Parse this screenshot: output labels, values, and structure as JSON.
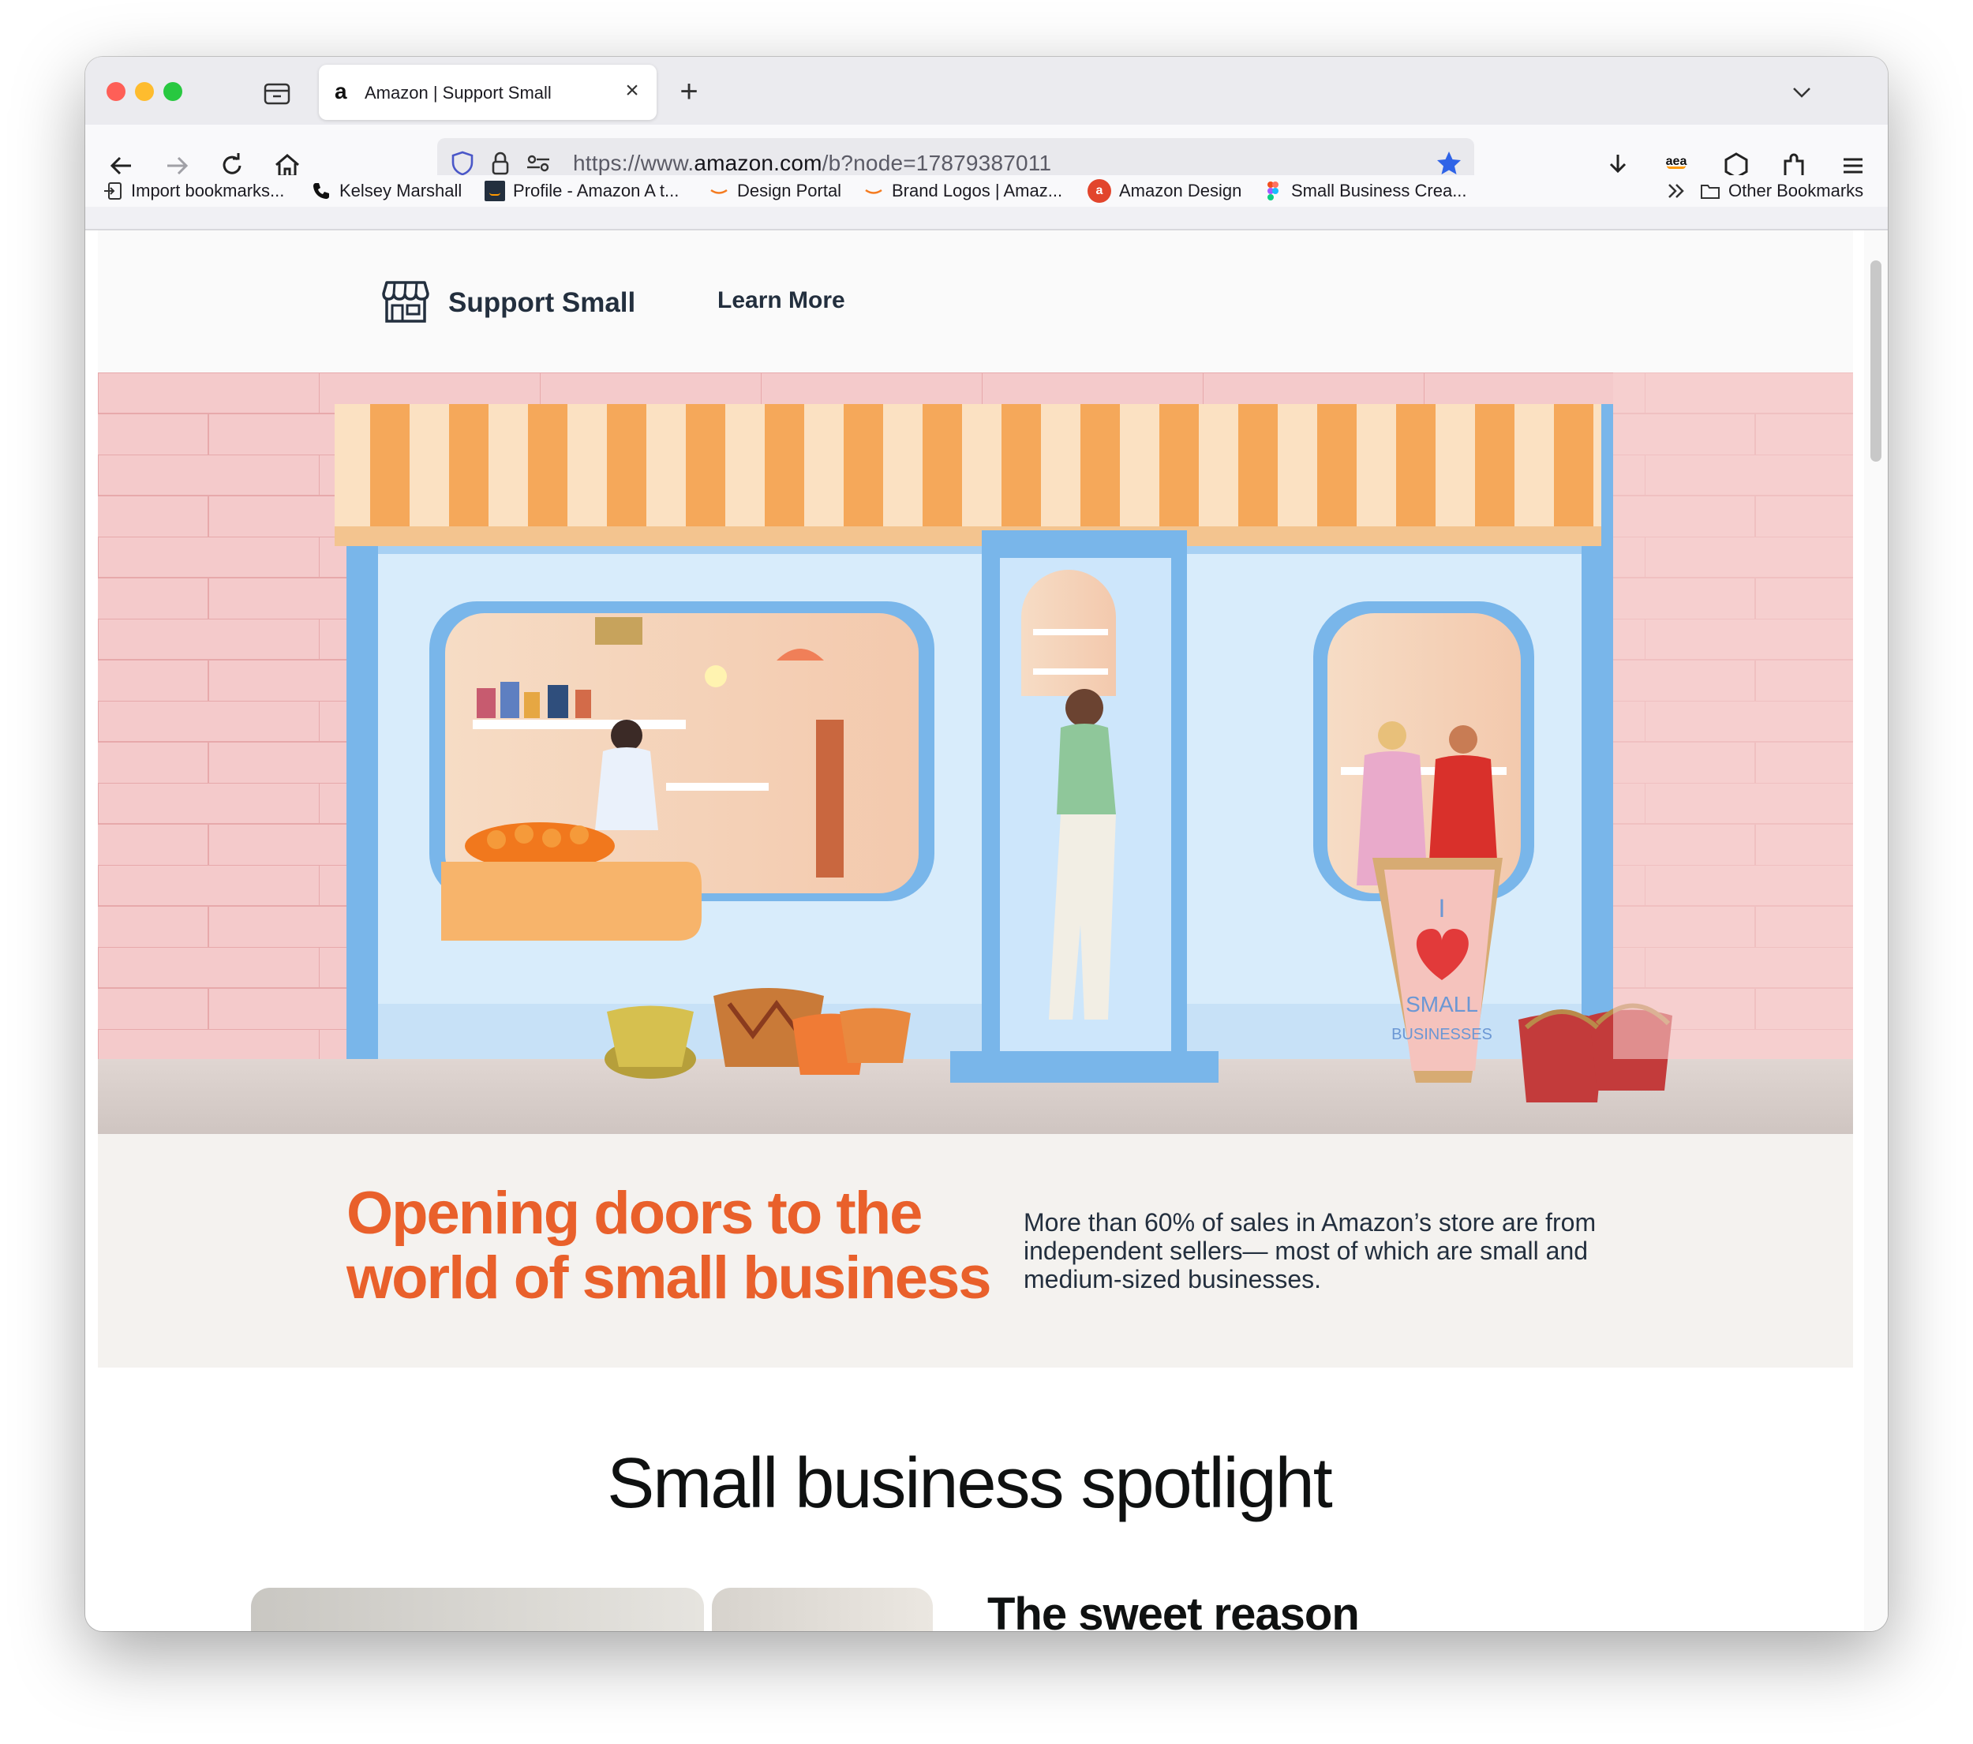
{
  "browser": {
    "tab": {
      "favicon": "a",
      "title": "Amazon | Support Small"
    },
    "url": {
      "prefix": "https://www.",
      "domain": "amazon.com",
      "path": "/b?node=17879387011"
    },
    "extension_label": "aea",
    "bookmarks": [
      {
        "label": "Import bookmarks...",
        "icon": "import-icon"
      },
      {
        "label": "Kelsey Marshall",
        "icon": "phone-icon"
      },
      {
        "label": "Profile - Amazon A t...",
        "icon": "amazon-dark-icon"
      },
      {
        "label": "Design Portal",
        "icon": "amazon-smile-icon"
      },
      {
        "label": "Brand Logos | Amaz...",
        "icon": "amazon-smile-icon"
      },
      {
        "label": "Amazon Design",
        "icon": "amazon-design-icon"
      },
      {
        "label": "Small Business Crea...",
        "icon": "figma-icon"
      }
    ],
    "other_bookmarks": "Other Bookmarks",
    "colors": {
      "bookmark_star": "#2f63e7"
    }
  },
  "header": {
    "brand": "Support Small",
    "learn_more": "Learn More"
  },
  "hero": {
    "sign_text_1": "I",
    "sign_text_2": "SMALL",
    "sign_text_3": "BUSINESSES"
  },
  "intro": {
    "headline": "Opening doors to the world of small business",
    "body": "More than 60% of sales in Amazon’s store are from independent sellers— most of which are small and medium-sized businesses."
  },
  "spotlight": {
    "title": "Small business spotlight",
    "card_heading": "The sweet reason"
  },
  "colors": {
    "accent_orange": "#e9602b",
    "text_dark": "#232f3e",
    "storefront_blue": "#78b4e8",
    "wall_pink": "#f3c8c8"
  }
}
